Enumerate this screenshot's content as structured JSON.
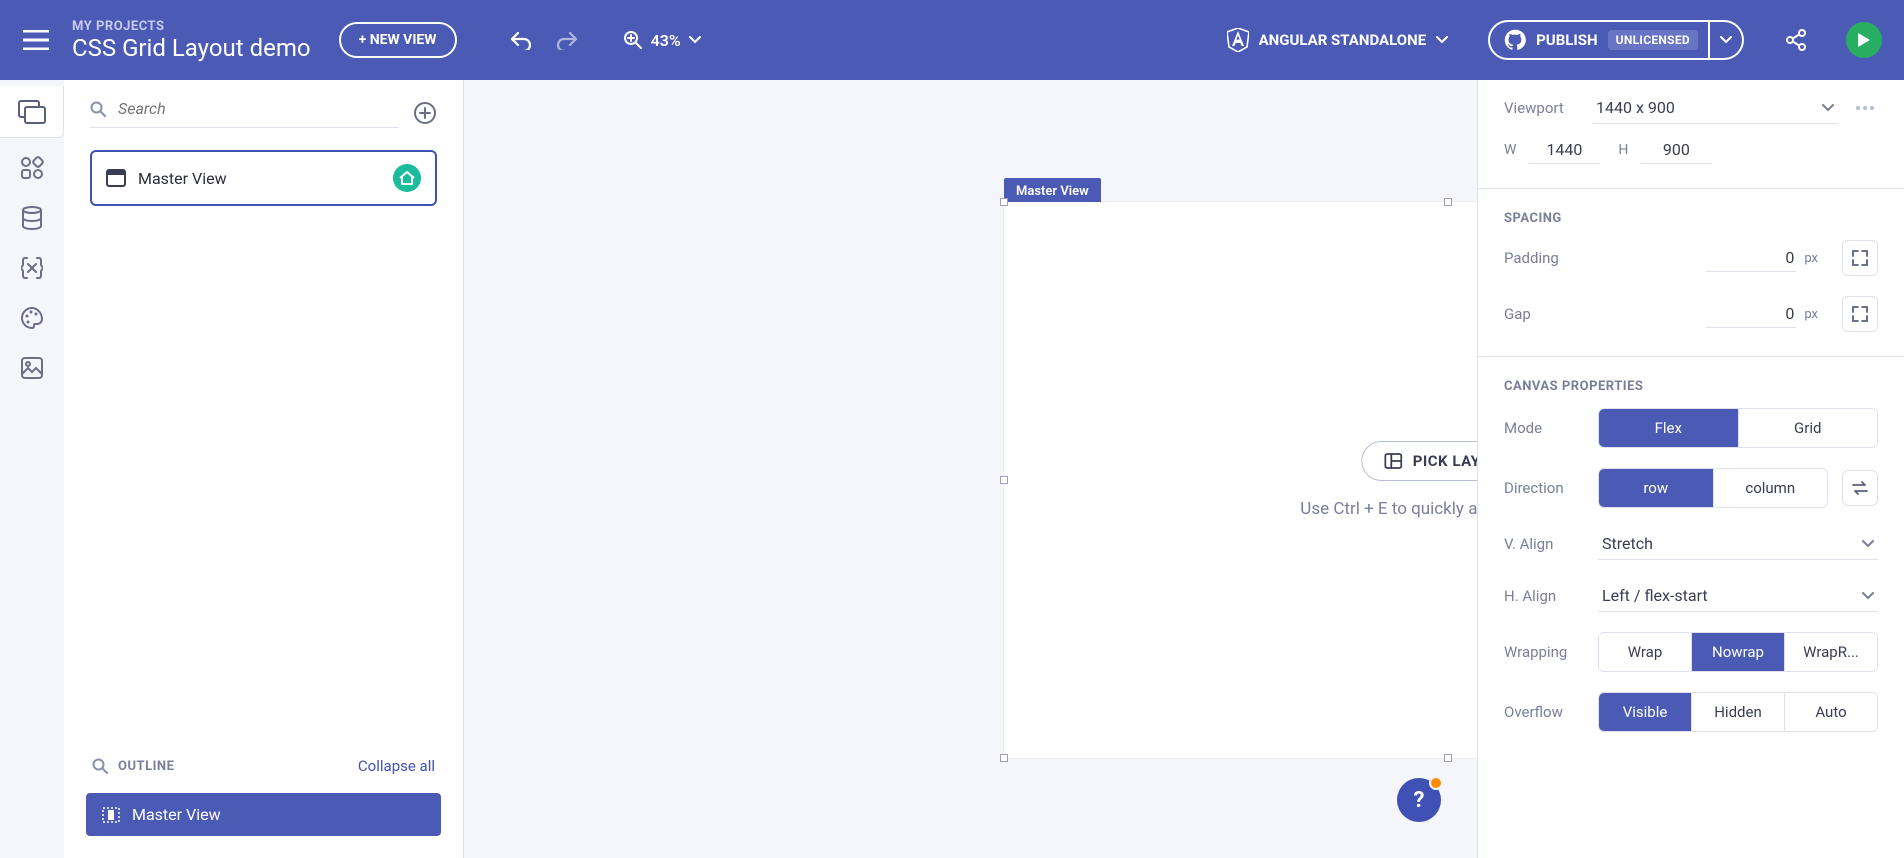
{
  "header": {
    "breadcrumb": "MY PROJECTS",
    "project_title": "CSS Grid Layout demo",
    "new_view": "+ NEW VIEW",
    "zoom": "43%",
    "framework": "ANGULAR STANDALONE",
    "publish": "PUBLISH",
    "license_badge": "UNLICENSED"
  },
  "left": {
    "search_placeholder": "Search",
    "views": [
      {
        "name": "Master View",
        "is_home": true
      }
    ],
    "outline_title": "OUTLINE",
    "collapse": "Collapse all",
    "outline_items": [
      {
        "name": "Master View"
      }
    ]
  },
  "canvas": {
    "tag": "Master View",
    "pick_layout": "PICK LAYOUT",
    "hint": "Use Ctrl + E to quickly add components",
    "help": "?"
  },
  "right": {
    "viewport": {
      "label": "Viewport",
      "value": "1440 x 900",
      "w_label": "W",
      "w": "1440",
      "h_label": "H",
      "h": "900"
    },
    "spacing": {
      "title": "SPACING",
      "padding_label": "Padding",
      "padding": "0",
      "gap_label": "Gap",
      "gap": "0",
      "unit": "px"
    },
    "canvas_props": {
      "title": "CANVAS PROPERTIES",
      "mode": {
        "label": "Mode",
        "options": [
          "Flex",
          "Grid"
        ],
        "active": "Flex"
      },
      "direction": {
        "label": "Direction",
        "options": [
          "row",
          "column"
        ],
        "active": "row"
      },
      "valign": {
        "label": "V. Align",
        "value": "Stretch"
      },
      "halign": {
        "label": "H. Align",
        "value": "Left / flex-start"
      },
      "wrapping": {
        "label": "Wrapping",
        "options": [
          "Wrap",
          "Nowrap",
          "WrapR..."
        ],
        "active": "Nowrap"
      },
      "overflow": {
        "label": "Overflow",
        "options": [
          "Visible",
          "Hidden",
          "Auto"
        ],
        "active": "Visible"
      }
    }
  }
}
